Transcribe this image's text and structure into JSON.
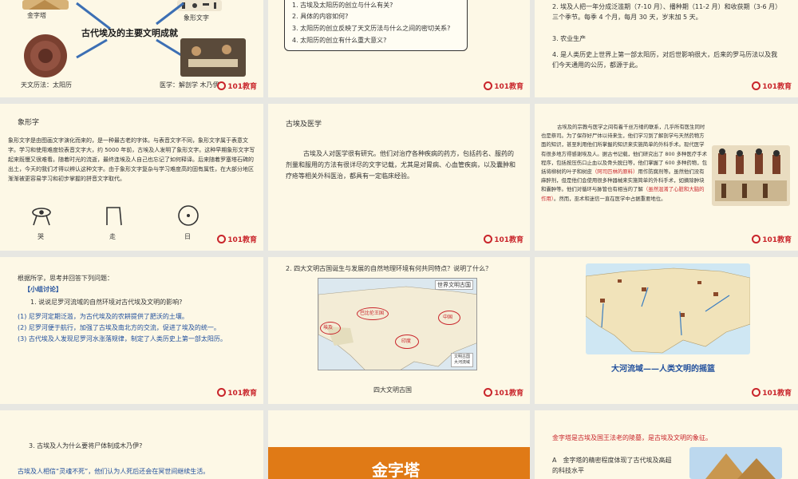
{
  "colors": {
    "slide_bg": "#fdf8e6",
    "accent_red": "#c9252b",
    "accent_blue": "#1f4e9c",
    "orange": "#e07a16"
  },
  "logo": "101教育",
  "s1": {
    "title": "古代埃及的主要文明成就",
    "cap_pyramid": "金字塔",
    "cap_hiero": "象形文字",
    "cap_calendar": "天文历法：太阳历",
    "cap_medicine": "医学：解剖学 木乃伊"
  },
  "s2": {
    "q1": "1. 古埃及太阳历的创立与什么有关?",
    "q2": "2. 具体的内容如何?",
    "q3": "3. 太阳历的创立反映了天文历法与什么之间的密切关系?",
    "q4": "4. 太阳历的创立有什么重大意义?"
  },
  "s3": {
    "p2": "2. 埃及人把一年分成泛滥期（7-10 月）、播种期（11-2 月）和收获期（3-6 月）三个季节。每季 4 个月，每月 30 天，岁末加 5 天。",
    "p3": "3. 农业生产",
    "p4": "4. 是人类历史上世界上第一部太阳历，对后世影响很大，后来的罗马历法以及我们今天通用的公历，都源于此。"
  },
  "s4": {
    "title": "象形字",
    "body": "象形文字是由图画文字演化而来的，是一种最古老的字体。与表音文字不同，象形文字属于表意文字。学习和使用难度较表音文字大，约 5000 年前，古埃及人发明了象形文字。这种早期象形文字写起来既慢又很难看。随着时光的流逝，最终连埃及人自己也忘记了如何释译。后来随着罗塞塔石碑的出土，今天的我们才得以辨认这种文字。由于象形文字复杂与学习难度高的固有属性，在大部分地区渐渐被更容易学习和初步掌握的拼音文字取代。",
    "g1": "哭",
    "g2": "走",
    "g3": "日"
  },
  "s5": {
    "title": "古埃及医学",
    "body": "古埃及人对医学很有研究。他们对治疗各种疾病的药方，包括药名、服药的剂量和服用的方法有很详尽的文字记载，尤其是对胃病、心血管疾病，以及囊肿和疗疮等相关外科医治，都具有一定临床经验。"
  },
  "s6": {
    "body_a": "古埃及的宗教与医学之间有着千丝万缕的联系，几乎所有医生同时也是祭司。为了保存好尸体以待来生，他们学习到了解剖学与天然药物方面的知识，甚至利用他们所掌握的知识来实施简单的外科手术。现代医学有很多地方得感谢埃及人。据古书记载，他们研究出了 800 多种医疗手术程序，包括按压伤口止血以及骨头脱臼等，他们掌握了 600 多种药物，包括将柳树的叶子和树皮",
    "red_a": "（阿司匹林的原料）",
    "body_b": "用作防腐剂等。虽然他们没有麻醉剂，但是他们会使用很多种器械来实施简单的外科手术，如摘除肿块和囊肿等。他们对循环与脉管也有相当的了解",
    "red_b": "（虽然混淆了心脏和大脑的作用）",
    "body_c": "。然而，巫术和迷信一直在医学中占据重要地位。"
  },
  "s7": {
    "intro": "根据所学，思考并回答下列问题：",
    "label": "【小组讨论】",
    "q": "1. 说说尼罗河流域的自然环境对古代埃及文明的影响?",
    "a1": "(1) 尼罗河定期泛滥，为古代埃及的农耕提供了肥沃的土壤。",
    "a2": "(2) 尼罗河便于航行，加强了古埃及南北方的交流，促进了埃及的统一。",
    "a3": "(3) 古代埃及人发现尼罗河水涨落规律，制定了人类历史上第一部太阳历。"
  },
  "s8": {
    "q": "2. 四大文明古国诞生与发展的自然地理环境有何共同特点？说明了什么？",
    "map_title": "世界文明古国",
    "label_egypt": "埃及",
    "label_babylon": "巴比伦王国",
    "label_india": "印度",
    "label_china": "中国",
    "legend_1": "文明古国",
    "legend_2": "大河流域",
    "caption": "四大文明古国"
  },
  "s9": {
    "caption": "大河流域——人类文明的摇篮"
  },
  "s10": {
    "q": "3. 古埃及人为什么要将尸体制成木乃伊?",
    "a": "古埃及人相信“灵魂不死”，他们认为人死后还会在冥世间继续生活。"
  },
  "s11": {
    "title": "金字塔"
  },
  "s12": {
    "title": "金字塔是古埃及国王法老的陵墓，是古埃及文明的象征。",
    "a": "A　金字塔的精密程度体现了古代埃及高超的科技水平"
  }
}
